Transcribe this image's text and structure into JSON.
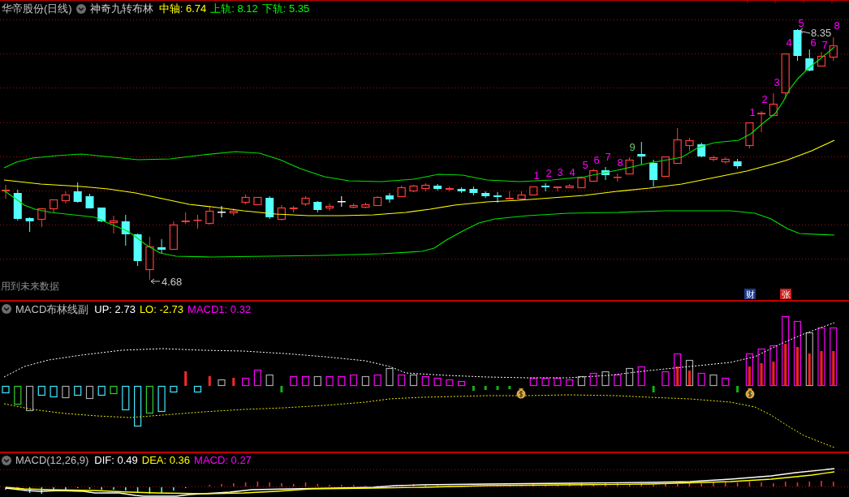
{
  "main_panel": {
    "title": "华帝股份(日线)",
    "indicator": "神奇九转布林",
    "legend": [
      {
        "text": "中轴: 6.74",
        "color": "#ffff00"
      },
      {
        "text": "上轨: 8.12",
        "color": "#00ff00"
      },
      {
        "text": "下轨: 5.35",
        "color": "#00ff00"
      }
    ],
    "sequence_counts": [
      {
        "text": "1",
        "color": "#ff00ff"
      },
      {
        "text": "2",
        "color": "#ff00ff"
      },
      {
        "text": "3",
        "color": "#ff00ff"
      },
      {
        "text": "4",
        "color": "#ff00ff"
      },
      {
        "text": "5",
        "color": "#ff00ff"
      },
      {
        "text": "6",
        "color": "#ff00ff"
      },
      {
        "text": "7",
        "color": "#ff00ff"
      },
      {
        "text": "8",
        "color": "#ff00ff"
      },
      {
        "text": "9",
        "color": "#6cc46c"
      },
      {
        "text": "1",
        "color": "#ff00ff"
      },
      {
        "text": "2",
        "color": "#ff00ff"
      },
      {
        "text": "3",
        "color": "#ff00ff"
      },
      {
        "text": "4",
        "color": "#ff00ff"
      },
      {
        "text": "5",
        "color": "#ff00ff"
      },
      {
        "text": "6",
        "color": "#ff00ff"
      },
      {
        "text": "7",
        "color": "#ff00ff"
      },
      {
        "text": "8",
        "color": "#ff00ff"
      }
    ],
    "price_markers": [
      {
        "text": "4.68"
      },
      {
        "text": "8.35"
      }
    ],
    "notice": "用到未来数据",
    "badges": [
      {
        "text": "财",
        "color": "#1c3c8c"
      },
      {
        "text": "张",
        "color": "#c81e1e"
      }
    ]
  },
  "macd_band_panel": {
    "title": "MACD布林线副",
    "legend": [
      {
        "text": "UP: 2.73",
        "color": "#ffffff"
      },
      {
        "text": "LO: -2.73",
        "color": "#ffff00"
      },
      {
        "text": "MACD1: 0.32",
        "color": "#ff00ff"
      }
    ]
  },
  "macd_panel": {
    "title": "MACD(12,26,9)",
    "legend": [
      {
        "text": "DIF: 0.49",
        "color": "#ffffff"
      },
      {
        "text": "DEA: 0.36",
        "color": "#ffff00"
      },
      {
        "text": "MACD: 0.27",
        "color": "#ff00ff"
      }
    ]
  }
}
